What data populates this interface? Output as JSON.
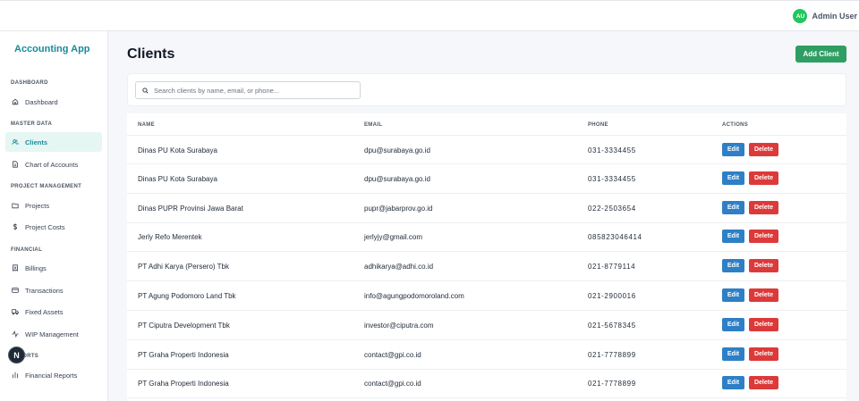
{
  "header": {
    "avatar_initials": "AU",
    "user_name": "Admin User"
  },
  "sidebar": {
    "brand": "Accounting App",
    "sections": [
      {
        "title": "DASHBOARD",
        "items": [
          {
            "label": "Dashboard",
            "icon": "home-icon"
          }
        ]
      },
      {
        "title": "MASTER DATA",
        "items": [
          {
            "label": "Clients",
            "icon": "users-icon",
            "active": true
          },
          {
            "label": "Chart of Accounts",
            "icon": "file-text-icon"
          }
        ]
      },
      {
        "title": "PROJECT MANAGEMENT",
        "items": [
          {
            "label": "Projects",
            "icon": "folder-icon"
          },
          {
            "label": "Project Costs",
            "icon": "dollar-icon"
          }
        ]
      },
      {
        "title": "FINANCIAL",
        "items": [
          {
            "label": "Billings",
            "icon": "receipt-icon"
          },
          {
            "label": "Transactions",
            "icon": "credit-card-icon"
          },
          {
            "label": "Fixed Assets",
            "icon": "truck-icon"
          },
          {
            "label": "WIP Management",
            "icon": "activity-icon"
          }
        ]
      },
      {
        "title": "REPORTS",
        "items": [
          {
            "label": "Financial Reports",
            "icon": "report-icon"
          }
        ]
      }
    ],
    "badge": "N"
  },
  "main": {
    "title": "Clients",
    "add_button": "Add Client",
    "search_placeholder": "Search clients by name, email, or phone...",
    "columns": [
      "NAME",
      "EMAIL",
      "PHONE",
      "ACTIONS"
    ],
    "edit_label": "Edit",
    "delete_label": "Delete",
    "rows": [
      {
        "name": "Dinas PU Kota Surabaya",
        "email": "dpu@surabaya.go.id",
        "phone": "031-3334455"
      },
      {
        "name": "Dinas PU Kota Surabaya",
        "email": "dpu@surabaya.go.id",
        "phone": "031-3334455"
      },
      {
        "name": "Dinas PUPR Provinsi Jawa Barat",
        "email": "pupr@jabarprov.go.id",
        "phone": "022-2503654"
      },
      {
        "name": "Jerly Refo Merentek",
        "email": "jerlyjy@gmail.com",
        "phone": "085823046414"
      },
      {
        "name": "PT Adhi Karya (Persero) Tbk",
        "email": "adhikarya@adhi.co.id",
        "phone": "021-8779114"
      },
      {
        "name": "PT Agung Podomoro Land Tbk",
        "email": "info@agungpodomoroland.com",
        "phone": "021-2900016"
      },
      {
        "name": "PT Ciputra Development Tbk",
        "email": "investor@ciputra.com",
        "phone": "021-5678345"
      },
      {
        "name": "PT Graha Properti Indonesia",
        "email": "contact@gpi.co.id",
        "phone": "021-7778899"
      },
      {
        "name": "PT Graha Properti Indonesia",
        "email": "contact@gpi.co.id",
        "phone": "021-7778899"
      }
    ]
  },
  "colors": {
    "brand": "#1a8a9a",
    "add": "#2f9e63",
    "edit": "#2e7fc5",
    "delete": "#dc3a3a",
    "active_bg": "#e6f7f3"
  }
}
